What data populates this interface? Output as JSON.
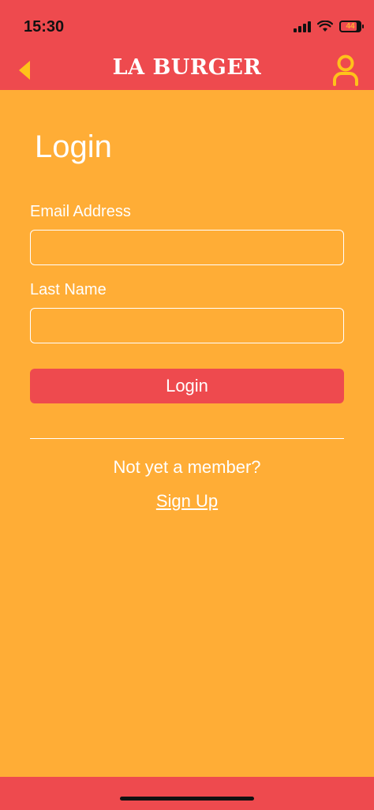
{
  "status_bar": {
    "time": "15:30",
    "battery_level": "44",
    "icons": [
      "signal-icon",
      "wifi-icon",
      "battery-icon"
    ]
  },
  "header": {
    "brand": "LA BURGER",
    "back_icon": "chevron-left-icon",
    "profile_icon": "user-icon"
  },
  "login": {
    "title": "Login",
    "email_label": "Email Address",
    "email_value": "",
    "last_name_label": "Last Name",
    "last_name_value": "",
    "submit_label": "Login",
    "member_prompt": "Not yet a member?",
    "signup_label": "Sign Up"
  },
  "colors": {
    "header_bg": "#EE4A4E",
    "page_bg": "#FFAD36",
    "accent_icon": "#FFC21A",
    "text": "#FFFFFF"
  }
}
